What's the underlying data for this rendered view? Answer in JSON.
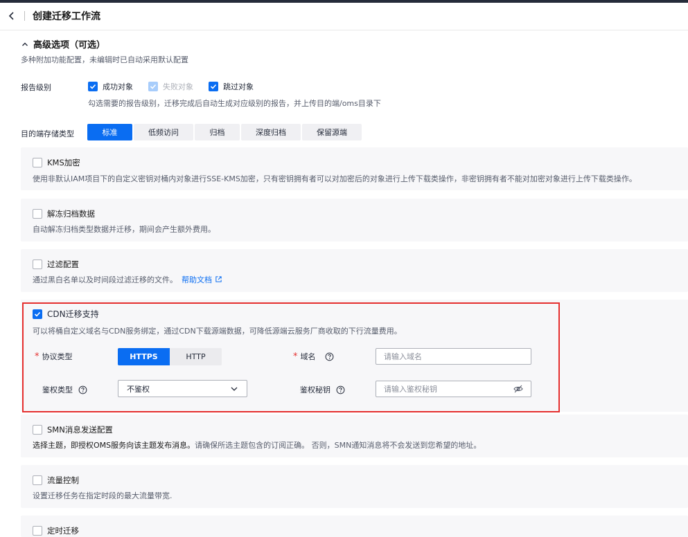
{
  "header": {
    "title": "创建迁移工作流"
  },
  "section": {
    "title": "高级选项（可选）",
    "subtitle": "多种附加功能配置，未编辑时已自动采用默认配置"
  },
  "report": {
    "label": "报告级别",
    "options": [
      {
        "label": "成功对象",
        "checked": true,
        "disabled": false
      },
      {
        "label": "失败对象",
        "checked": true,
        "disabled": true
      },
      {
        "label": "跳过对象",
        "checked": true,
        "disabled": false
      }
    ],
    "hint": "勾选需要的报告级别，迁移完成后自动生成对应级别的报告，并上传目的端/oms目录下"
  },
  "storage": {
    "label": "目的端存储类型",
    "options": [
      "标准",
      "低频访问",
      "归档",
      "深度归档",
      "保留源端"
    ],
    "selected": "标准"
  },
  "kms": {
    "title": "KMS加密",
    "checked": false,
    "desc": "使用非默认IAM项目下的自定义密钥对桶内对象进行SSE-KMS加密，只有密钥拥有者可以对加密后的对象进行上传下载类操作，非密钥拥有者不能对加密对象进行上传下载类操作。"
  },
  "thaw": {
    "title": "解冻归档数据",
    "checked": false,
    "desc": "自动解冻归档类型数据并迁移，期间会产生额外费用。"
  },
  "filter": {
    "title": "过滤配置",
    "checked": false,
    "desc": "通过黑白名单以及时间段过滤迁移的文件。",
    "link": "帮助文档"
  },
  "cdn": {
    "title": "CDN迁移支持",
    "checked": true,
    "desc": "可以将桶自定义域名与CDN服务绑定，通过CDN下载源端数据，可降低源端云服务厂商收取的下行流量费用。",
    "protocol_label": "协议类型",
    "protocols": [
      "HTTPS",
      "HTTP"
    ],
    "protocol_selected": "HTTPS",
    "domain_label": "域名",
    "domain_placeholder": "请输入域名",
    "auth_type_label": "鉴权类型",
    "auth_type_value": "不鉴权",
    "auth_key_label": "鉴权秘钥",
    "auth_key_placeholder": "请输入鉴权秘钥"
  },
  "smn": {
    "title": "SMN消息发送配置",
    "checked": false,
    "desc_main": "选择主题，即授权OMS服务向该主题发布消息。",
    "desc_rest": "请确保所选主题包含的订阅正确。 否则，SMN通知消息将不会发送到您希望的地址。"
  },
  "flow": {
    "title": "流量控制",
    "checked": false,
    "desc": "设置迁移任务在指定时段的最大流量带宽."
  },
  "schedule": {
    "title": "定时迁移",
    "checked": false
  },
  "colors": {
    "primary": "#0a6df2",
    "highlight_border": "#e52e2e",
    "card_bg": "#f7f7f9"
  }
}
